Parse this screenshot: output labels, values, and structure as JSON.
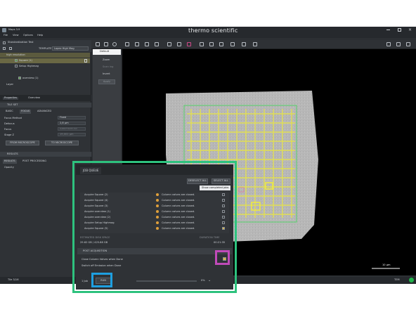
{
  "app": {
    "title": "Maps 3.9",
    "brand": "thermo scientific",
    "menu": [
      "File",
      "View",
      "Options",
      "Help"
    ]
  },
  "project": {
    "name": "Standardization Test"
  },
  "layers": {
    "template_label": "TEMPLATE",
    "template_value": "Lopez High Mag",
    "items": [
      "high resolution",
      "Square (1)",
      "Setup Highmag",
      "overview (1)",
      "Layer"
    ]
  },
  "right_panel": {
    "items": [
      "Default",
      "Zoom",
      "Scan ing",
      "Invert",
      "Apply"
    ]
  },
  "properties": {
    "tabs": [
      "Properties",
      "Overview"
    ],
    "tileset_header": "TILE SET",
    "subtabs": [
      "BASIC",
      "FOCUS",
      "ADVANCED"
    ],
    "focus_method_label": "Focus Method",
    "focus_method_value": "Fixed",
    "defocus_label": "Defocus",
    "defocus_value": "2,8 µm",
    "focus_label": "Focus",
    "focus_value": "0,000774433 mm",
    "stage_z_label": "Stage Z",
    "stage_z_value": "19,001 µm",
    "from_microscope": "FROM MICROSCOPE",
    "to_microscope": "TO MICROSCOPE",
    "results_header": "RESULTS",
    "result_tabs": [
      "RESULTS",
      "POST PROCESSING"
    ],
    "opacity_label": "Opacity"
  },
  "job_queue": {
    "tab": "JOB QUEUE",
    "deselect_all": "DESELECT ALL",
    "select_all": "SELECT ALL",
    "show_completed": "Show completed jobs",
    "jobs": [
      {
        "name": "Acquire Square (2)",
        "status": "Column valves are closed."
      },
      {
        "name": "Acquire Square (4)",
        "status": "Column valves are closed."
      },
      {
        "name": "Acquire Square (3)",
        "status": "Column valves are closed."
      },
      {
        "name": "Acquire overview (1)",
        "status": "Column valves are closed."
      },
      {
        "name": "Acquire overview (2)",
        "status": "Column valves are closed."
      },
      {
        "name": "Acquire Setup Highmag",
        "status": "Column valves are closed."
      },
      {
        "name": "Acquire Square (5)",
        "status": "Column valves are closed."
      }
    ],
    "estimated_disk_label": "ESTIMATED DISK SPACE",
    "estimated_disk_value": "29.62 GB / 425.88 GB",
    "duration_label": "DURATION TIME",
    "duration_value": "00:21:35",
    "post_acq_header": "POST ACQUISITION",
    "close_valves_label": "Close Column Valves when Done",
    "switch_off_label": "Switch off Emission when Done",
    "list_label": "1 Job",
    "run_label": "RUN",
    "progress_pct": "0%"
  },
  "status": {
    "left": "Tile 3/16",
    "scale": "10 µm",
    "right": "TEM"
  },
  "colors": {
    "accent": "#2ec27e",
    "highlight": "#c04ab8",
    "run_highlight": "#1e9fe0",
    "grid": "#e6e34a"
  }
}
